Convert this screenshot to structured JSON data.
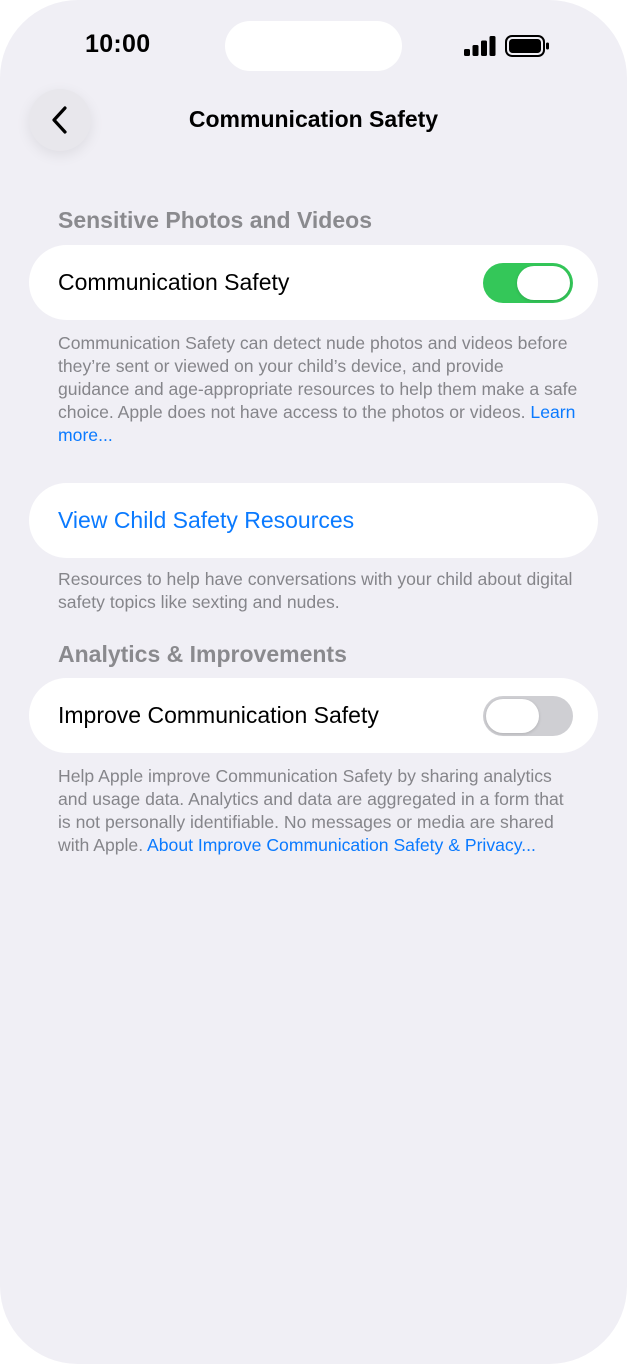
{
  "status_bar": {
    "time": "10:00",
    "signal_icon": "cellular-signal-icon",
    "battery_icon": "battery-full-icon"
  },
  "nav": {
    "back_icon": "chevron-left-icon",
    "title": "Communication Safety"
  },
  "sections": {
    "sensitive": {
      "header": "Sensitive Photos and Videos",
      "toggle_label": "Communication Safety",
      "toggle_on": true,
      "footer": "Communication Safety can detect nude photos and videos before they’re sent or viewed on your child’s device, and provide guidance and age-appropriate resources to help them make a safe choice. Apple does not have access to the photos or videos.",
      "footer_link": "Learn more..."
    },
    "resources": {
      "link_label": "View Child Safety Resources",
      "footer": "Resources to help have conversations with your child about digital safety topics like sexting and nudes."
    },
    "analytics": {
      "header": "Analytics & Improvements",
      "toggle_label": "Improve Communication Safety",
      "toggle_on": false,
      "footer": "Help Apple improve Communication Safety by sharing analytics and usage data. Analytics and data are aggregated in a form that is not personally identifiable. No messages or media are shared with Apple.",
      "footer_link": "About Improve Communication Safety & Privacy..."
    }
  },
  "colors": {
    "background": "#f0eff5",
    "accent": "#0a7aff",
    "toggle_on": "#34c759",
    "toggle_off": "#cfcfd3"
  }
}
